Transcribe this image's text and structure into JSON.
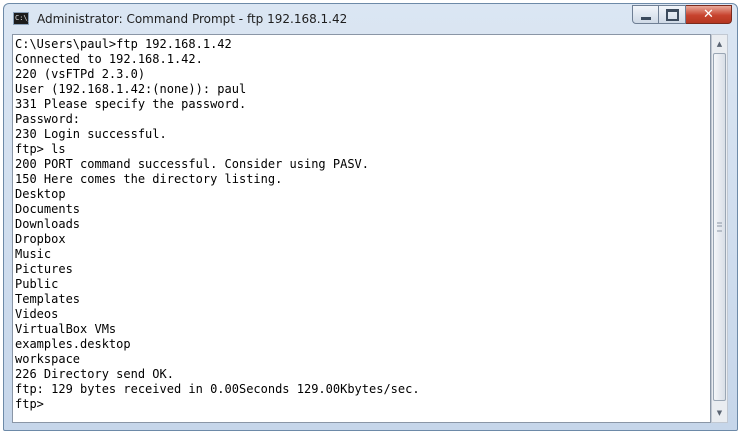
{
  "window": {
    "title": "Administrator: Command Prompt - ftp  192.168.1.42",
    "app_icon_text": "C:\\_"
  },
  "caption_buttons": {
    "minimize": "minimize-icon",
    "maximize": "maximize-icon",
    "close": "close-icon",
    "close_glyph": "✕"
  },
  "console": {
    "lines": [
      "C:\\Users\\paul>ftp 192.168.1.42",
      "Connected to 192.168.1.42.",
      "220 (vsFTPd 2.3.0)",
      "User (192.168.1.42:(none)): paul",
      "331 Please specify the password.",
      "Password:",
      "230 Login successful.",
      "ftp> ls",
      "200 PORT command successful. Consider using PASV.",
      "150 Here comes the directory listing.",
      "Desktop",
      "Documents",
      "Downloads",
      "Dropbox",
      "Music",
      "Pictures",
      "Public",
      "Templates",
      "Videos",
      "VirtualBox VMs",
      "examples.desktop",
      "workspace",
      "226 Directory send OK.",
      "ftp: 129 bytes received in 0.00Seconds 129.00Kbytes/sec.",
      "ftp>"
    ]
  },
  "scrollbar": {
    "up_arrow": "▲",
    "down_arrow": "▼",
    "position_fraction": 0.0
  },
  "colors": {
    "console_background": "#ffffff",
    "console_text": "#000000",
    "close_button": "#c7432e"
  }
}
